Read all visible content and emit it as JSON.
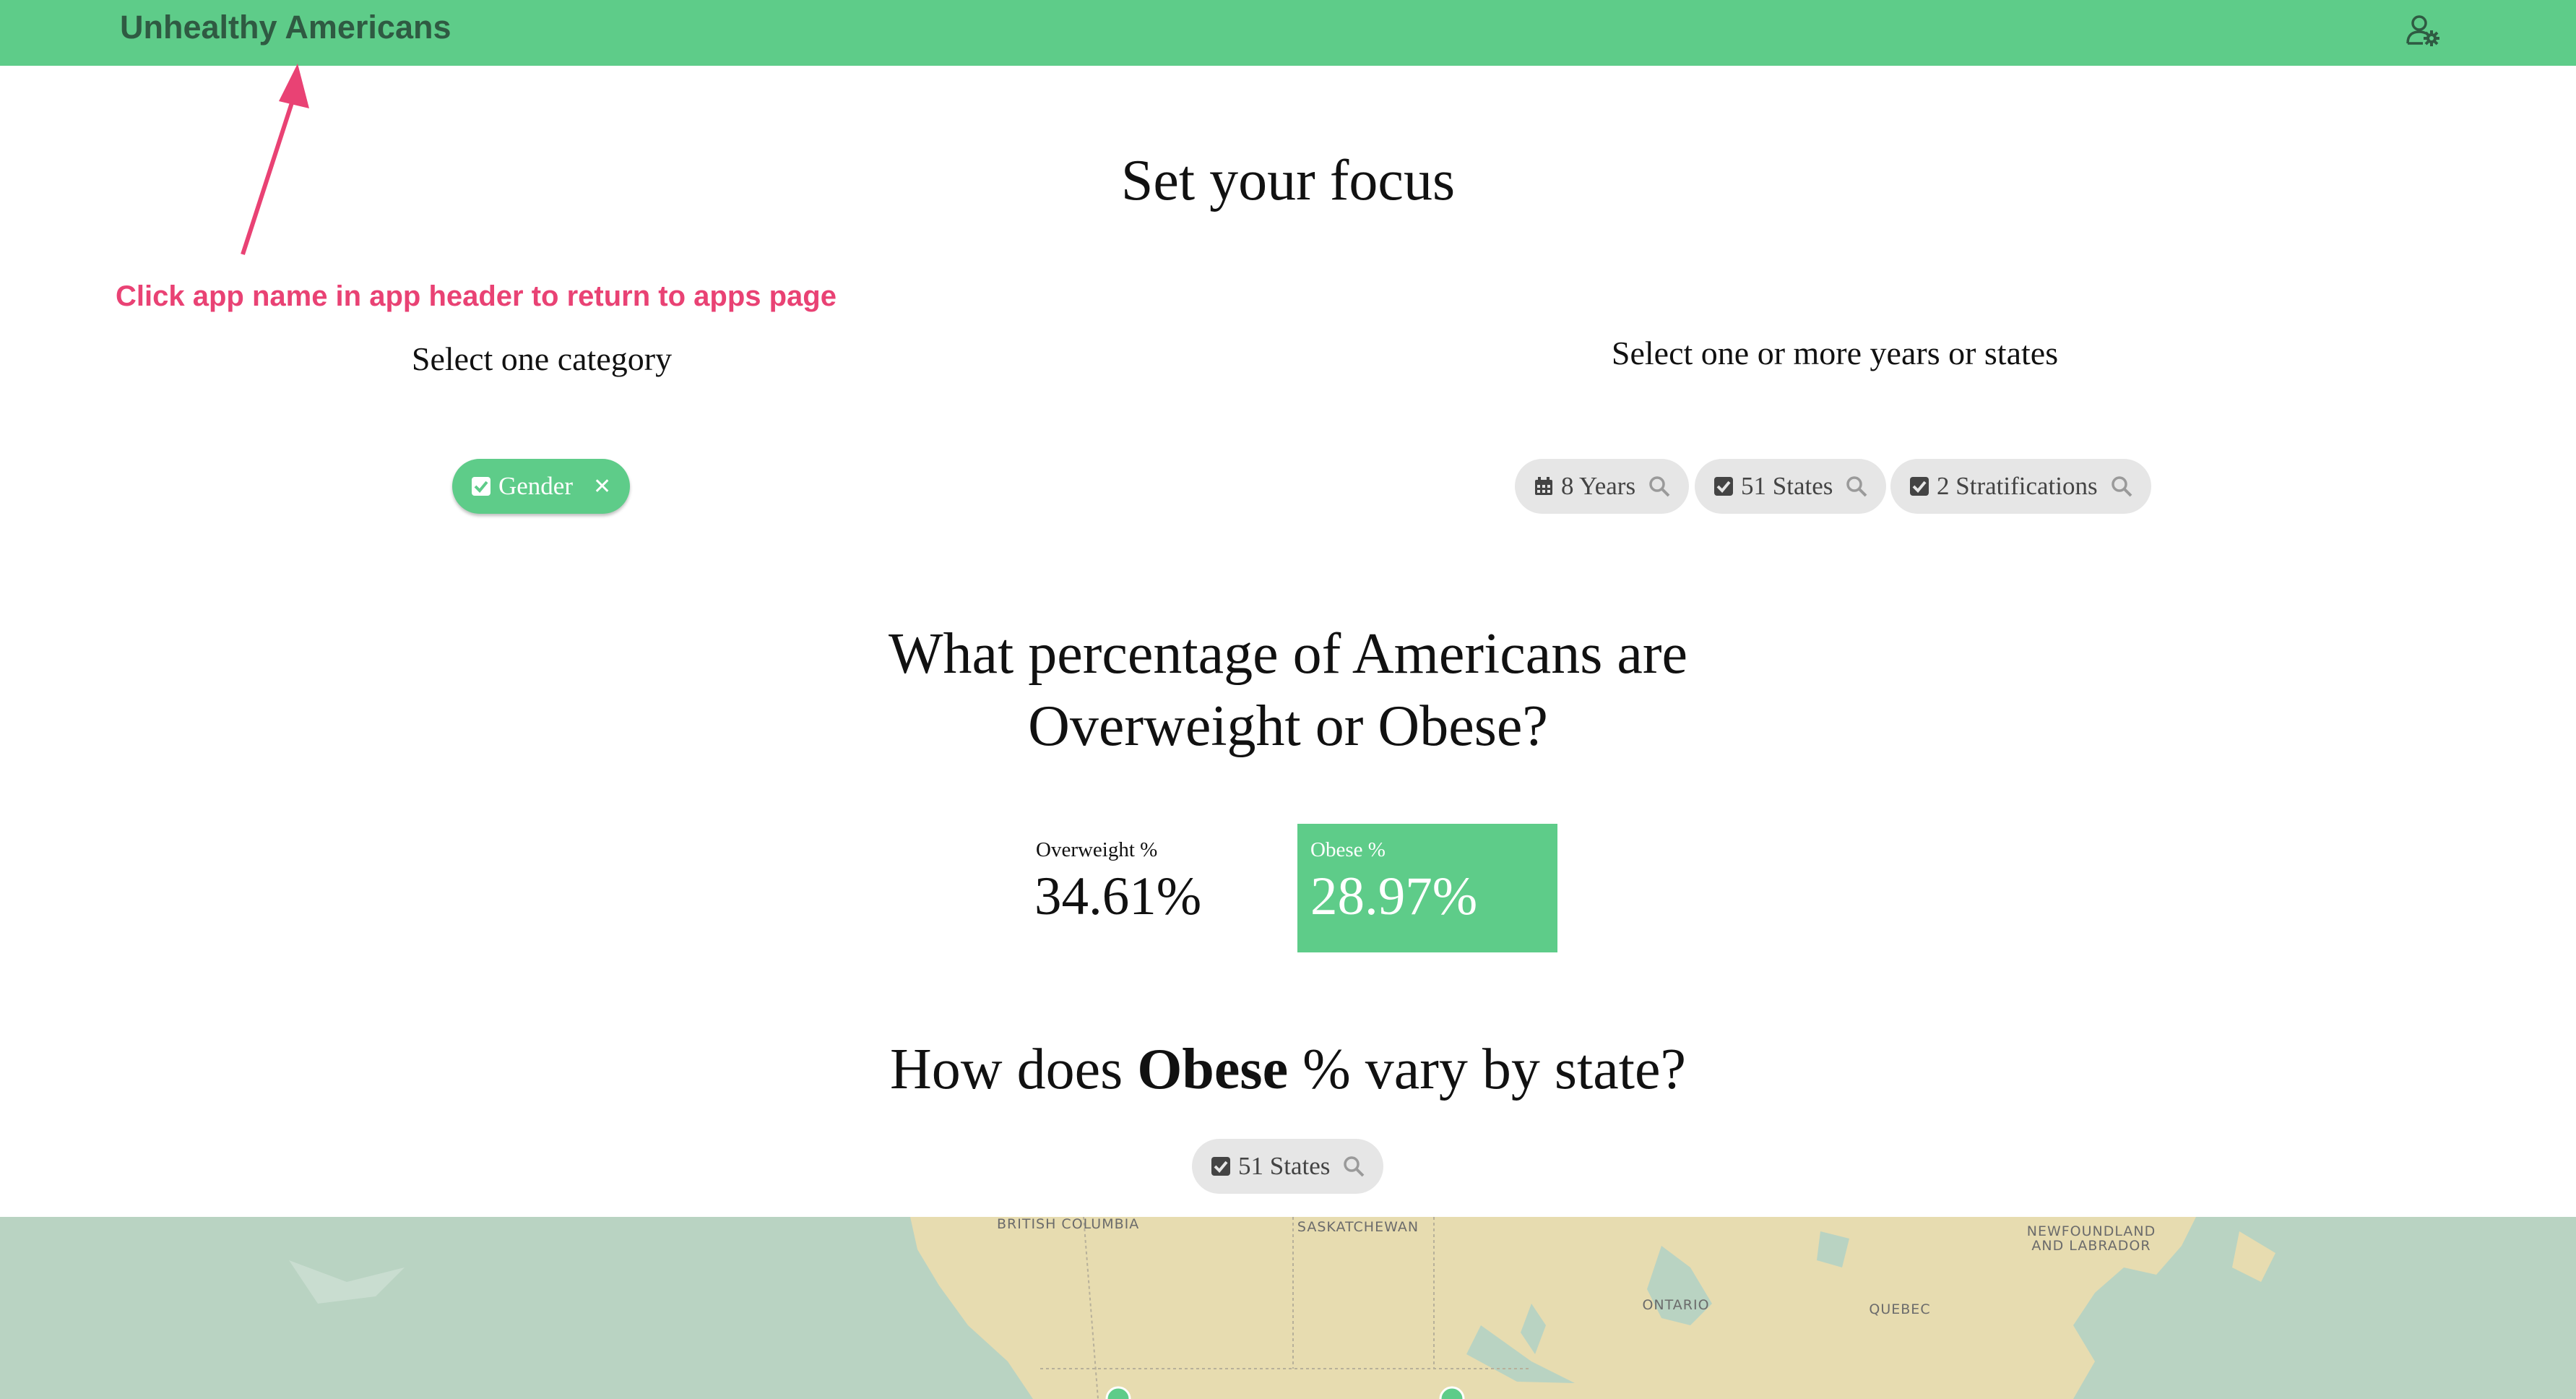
{
  "header": {
    "app_name": "Unhealthy Americans",
    "user_icon": "user-gear-icon"
  },
  "annotation": {
    "text": "Click app name in app header to return to apps page"
  },
  "focus": {
    "title": "Set your focus",
    "category_label": "Select one category",
    "years_label": "Select one or more years or states",
    "category_chip": {
      "label": "Gender",
      "icon": "check-square-icon",
      "remove_icon": "close-icon"
    },
    "filter_chips": [
      {
        "label": "8 Years",
        "icon": "calendar-icon"
      },
      {
        "label": "51 States",
        "icon": "check-square-icon"
      },
      {
        "label": "2 Stratifications",
        "icon": "check-square-icon"
      }
    ]
  },
  "question": {
    "line1": "What percentage of Americans are",
    "line2": "Overweight or Obese?"
  },
  "kpis": [
    {
      "label": "Overweight %",
      "value": "34.61%"
    },
    {
      "label": "Obese %",
      "value": "28.97%",
      "selected": true
    }
  ],
  "map_section": {
    "title_pre": "How does ",
    "title_bold": "Obese",
    "title_post": " % vary by state?",
    "states_chip": {
      "label": "51 States",
      "icon": "check-square-icon"
    }
  },
  "map": {
    "labels": [
      "BRITISH COLUMBIA",
      "SASKATCHEWAN",
      "NEWFOUNDLAND AND LABRADOR",
      "ONTARIO",
      "QUEBEC"
    ],
    "water_color": "#b9d3c2",
    "land_color": "#e7dcb0"
  },
  "colors": {
    "accent": "#5ecc89",
    "header_text": "#2f5a42",
    "annotation": "#e94274"
  }
}
